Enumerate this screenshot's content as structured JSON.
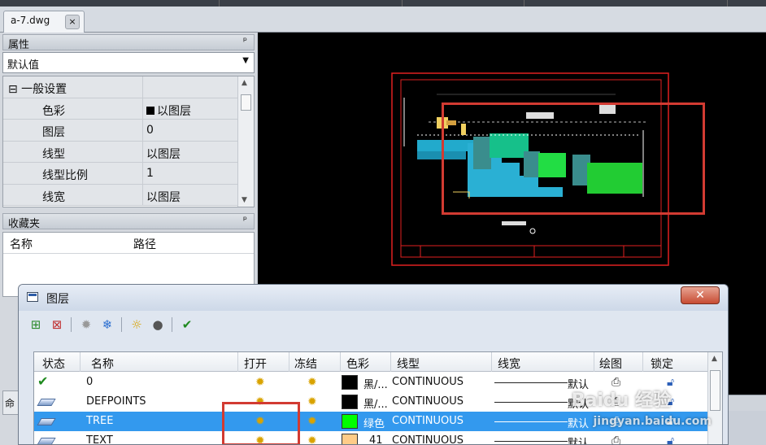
{
  "document": {
    "tab_label": "a-7.dwg",
    "close_glyph": "×"
  },
  "properties_panel": {
    "title": "属性",
    "pin_glyph": "ᵖ",
    "selector_value": "默认值",
    "rows": [
      {
        "key": "⊟ 一般设置",
        "value": ""
      },
      {
        "key": "色彩",
        "value": "以图层"
      },
      {
        "key": "图层",
        "value": "0"
      },
      {
        "key": "线型",
        "value": "以图层"
      },
      {
        "key": "线型比例",
        "value": "1"
      },
      {
        "key": "线宽",
        "value": "以图层"
      }
    ]
  },
  "favorites_panel": {
    "title": "收藏夹",
    "columns": [
      "名称",
      "路径"
    ],
    "side_tab": "命"
  },
  "layer_dialog": {
    "title": "图层",
    "close_glyph": "✕",
    "toolbar": [
      {
        "name": "new-layer-icon",
        "glyph": "⊞"
      },
      {
        "name": "delete-layer-icon",
        "glyph": "⊠"
      },
      {
        "name": "freeze-all-icon",
        "glyph": "✹"
      },
      {
        "name": "snowflake-icon",
        "glyph": "❄"
      },
      {
        "name": "sun-icon",
        "glyph": "☼"
      },
      {
        "name": "bulb-icon",
        "glyph": "●"
      },
      {
        "name": "apply-check-icon",
        "glyph": "✔"
      }
    ],
    "columns": [
      "状态",
      "名称",
      "打开",
      "冻结",
      "色彩",
      "线型",
      "线宽",
      "绘图",
      "锁定"
    ],
    "rows": [
      {
        "status": "current",
        "name": "0",
        "color_hex": "#000000",
        "color_label": "黑/...",
        "linetype": "CONTINUOUS",
        "lineweight": "默认",
        "selected": false
      },
      {
        "status": "layer",
        "name": "DEFPOINTS",
        "color_hex": "#000000",
        "color_label": "黑/...",
        "linetype": "CONTINUOUS",
        "lineweight": "默认",
        "selected": false
      },
      {
        "status": "layer",
        "name": "TREE",
        "color_hex": "#00ff00",
        "color_label": "绿色",
        "linetype": "CONTINUOUS",
        "lineweight": "默认",
        "selected": true
      },
      {
        "status": "layer",
        "name": "TEXT",
        "color_hex": "#ffcc88",
        "color_label": "41",
        "linetype": "CONTINUOUS",
        "lineweight": "默认",
        "selected": false
      }
    ]
  },
  "watermark": {
    "brand": "Baidu 经验",
    "url": "jingyan.baidu.com"
  },
  "colors": {
    "highlight": "#d23b32",
    "selection": "#3399ee",
    "canvas": "#000000"
  }
}
